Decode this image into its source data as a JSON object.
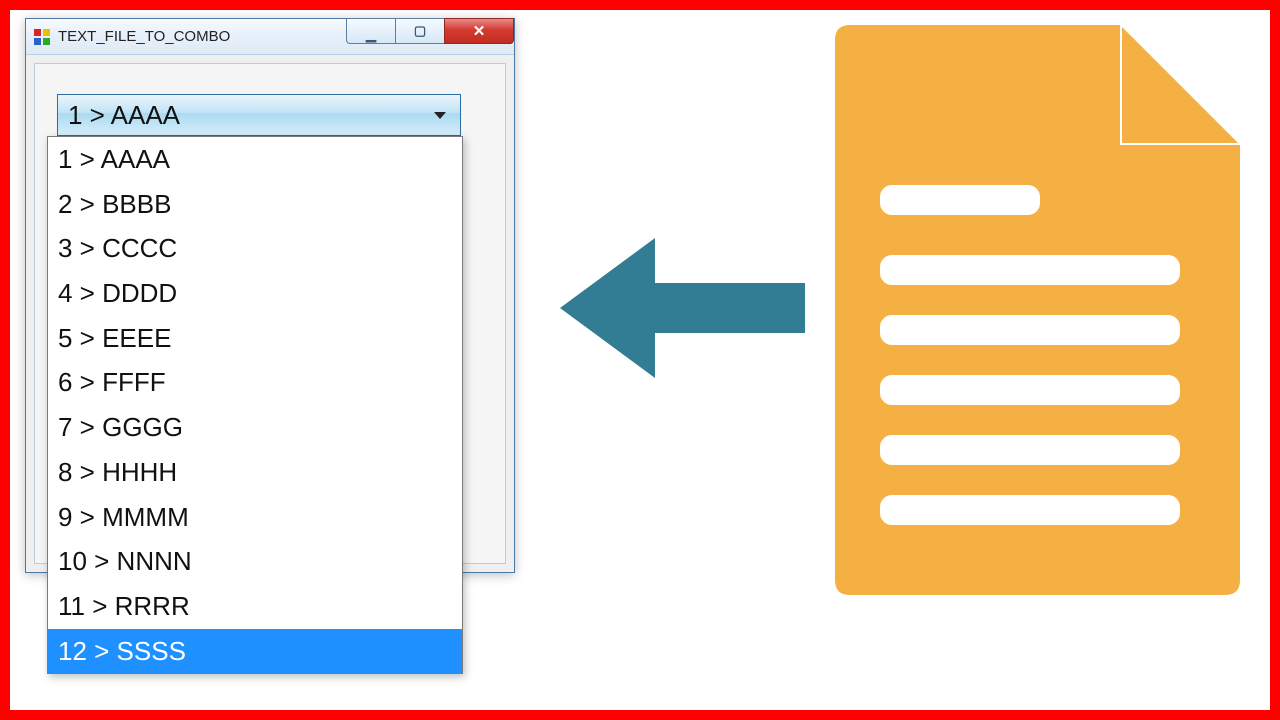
{
  "window": {
    "title": "TEXT_FILE_TO_COMBO"
  },
  "combo": {
    "selected": "1 > AAAA",
    "items": [
      "1 > AAAA",
      "2 > BBBB",
      "3 > CCCC",
      "4 > DDDD",
      "5 > EEEE",
      "6 > FFFF",
      "7 > GGGG",
      "8 > HHHH",
      "9 > MMMM",
      "10 > NNNN",
      "11 > RRRR",
      "12 > SSSS"
    ],
    "highlighted_index": 11
  },
  "colors": {
    "frame_border": "#ff0000",
    "file_icon": "#f4b042",
    "arrow": "#337d94",
    "list_highlight": "#1e90ff"
  }
}
